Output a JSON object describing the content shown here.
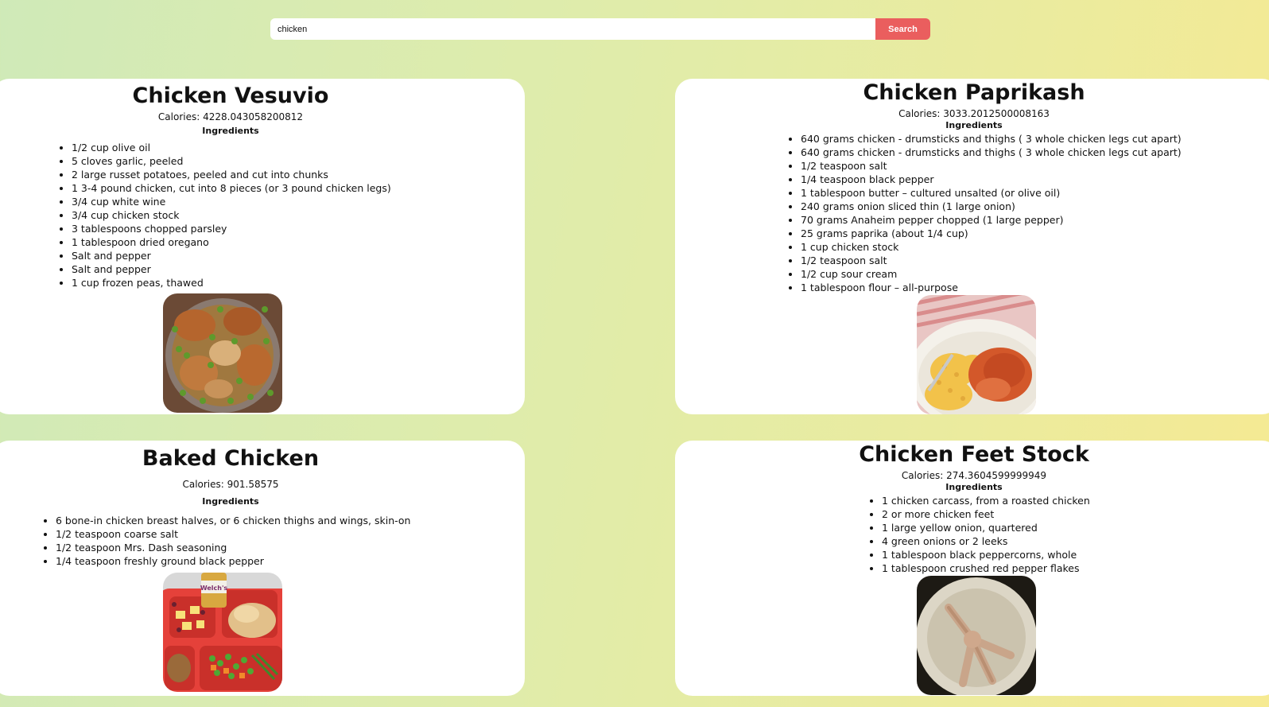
{
  "search": {
    "value": "chicken",
    "button_label": "Search"
  },
  "colors": {
    "accent": "#ea5e5e",
    "background_start": "#cfeab8",
    "background_end": "#f6ea92",
    "card": "#ffffff"
  },
  "recipes": [
    {
      "title": "Chicken Vesuvio",
      "calories": "Calories: 4228.043058200812",
      "ingredients_heading": "Ingredients",
      "ingredients": [
        "1/2 cup olive oil",
        "5 cloves garlic, peeled",
        "2 large russet potatoes, peeled and cut into chunks",
        "1 3-4 pound chicken, cut into 8 pieces (or 3 pound chicken legs)",
        "3/4 cup white wine",
        "3/4 cup chicken stock",
        "3 tablespoons chopped parsley",
        "1 tablespoon dried oregano",
        "Salt and pepper",
        "Salt and pepper",
        "1 cup frozen peas, thawed"
      ],
      "image_icon": "chicken-vesuvio-photo"
    },
    {
      "title": "Chicken Paprikash",
      "calories": "Calories: 3033.2012500008163",
      "ingredients_heading": "Ingredients",
      "ingredients": [
        "640 grams chicken - drumsticks and thighs ( 3 whole chicken legs cut apart)",
        "640 grams chicken - drumsticks and thighs ( 3 whole chicken legs cut apart)",
        "1/2 teaspoon salt",
        "1/4 teaspoon black pepper",
        "1 tablespoon butter – cultured unsalted (or olive oil)",
        "240 grams onion sliced thin (1 large onion)",
        "70 grams Anaheim pepper chopped (1 large pepper)",
        "25 grams paprika (about 1/4 cup)",
        "1 cup chicken stock",
        "1/2 teaspoon salt",
        "1/2 cup sour cream",
        "1 tablespoon flour – all-purpose"
      ],
      "image_icon": "chicken-paprikash-photo"
    },
    {
      "title": "Baked Chicken",
      "calories": "Calories: 901.58575",
      "ingredients_heading": "Ingredients",
      "ingredients": [
        "6 bone-in chicken breast halves, or 6 chicken thighs and wings, skin-on",
        "1/2 teaspoon coarse salt",
        "1/2 teaspoon Mrs. Dash seasoning",
        "1/4 teaspoon freshly ground black pepper"
      ],
      "image_icon": "baked-chicken-photo",
      "image_label": "Welch's"
    },
    {
      "title": "Chicken Feet Stock",
      "calories": "Calories: 274.3604599999949",
      "ingredients_heading": "Ingredients",
      "ingredients": [
        "1 chicken carcass, from a roasted chicken",
        "2 or more chicken feet",
        "1 large yellow onion, quartered",
        "4 green onions or 2 leeks",
        "1 tablespoon black peppercorns, whole",
        "1 tablespoon crushed red pepper flakes"
      ],
      "image_icon": "chicken-feet-stock-photo"
    }
  ]
}
